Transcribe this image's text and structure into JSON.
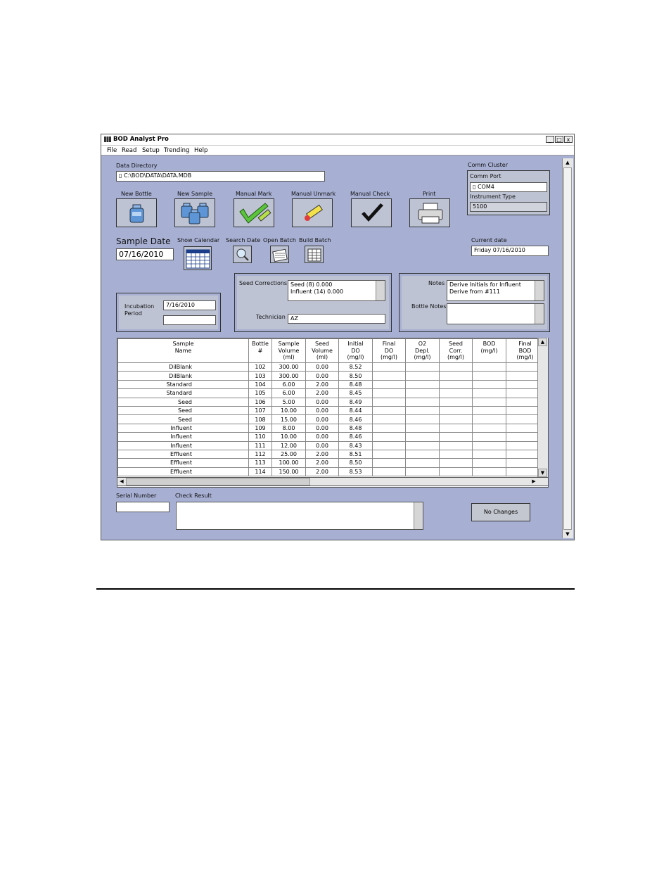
{
  "window": {
    "title": "BOD Analyst Pro",
    "min": "_",
    "max": "□",
    "close": "x"
  },
  "menu": [
    "File",
    "Read",
    "Setup",
    "Trending",
    "Help"
  ],
  "data_directory": {
    "label": "Data Directory",
    "value": "C:\\BOD\\DATA\\DATA.MDB"
  },
  "comm": {
    "cluster_label": "Comm Cluster",
    "port_label": "Comm Port",
    "port_value": "COM4",
    "instrument_label": "Instrument Type",
    "instrument_value": "5100"
  },
  "toolbar": {
    "new_bottle": "New Bottle",
    "new_sample": "New Sample",
    "manual_mark": "Manual Mark",
    "manual_unmark": "Manual Unmark",
    "manual_check": "Manual Check",
    "print": "Print"
  },
  "sample_date": {
    "label": "Sample Date",
    "value": "07/16/2010"
  },
  "small_buttons": {
    "show_calendar": "Show Calendar",
    "search_date": "Search Date",
    "open_batch": "Open Batch",
    "build_batch": "Build Batch"
  },
  "current_date": {
    "label": "Current date",
    "value": "Friday 07/16/2010"
  },
  "incubation": {
    "label_line1": "Incubation",
    "label_line2": "Period",
    "value": "7/16/2010",
    "value2": ""
  },
  "seed": {
    "label": "Seed Corrections",
    "line1": "Seed (8)       0.000",
    "line2": "Influent (14)      0.000",
    "tech_label": "Technician",
    "tech_value": "AZ"
  },
  "notes": {
    "label": "Notes",
    "line1": "Derive Initials for Influent",
    "line2": "Derive from #111",
    "bottle_label": "Bottle Notes"
  },
  "table": {
    "headers": [
      [
        "Sample",
        "Name"
      ],
      [
        "Bottle",
        "#"
      ],
      [
        "Sample",
        "Volume",
        "(ml)"
      ],
      [
        "Seed",
        "Volume",
        "(ml)"
      ],
      [
        "Initial",
        "DO",
        "(mg/l)"
      ],
      [
        "Final",
        "DO",
        "(mg/l)"
      ],
      [
        "O2",
        "Depl.",
        "(mg/l)"
      ],
      [
        "Seed",
        "Corr.",
        "(mg/l)"
      ],
      [
        "BOD",
        "(mg/l)"
      ],
      [
        "Final",
        "BOD",
        "(mg/l)"
      ]
    ],
    "rows": [
      [
        "DilBlank",
        "102",
        "300.00",
        "0.00",
        "8.52"
      ],
      [
        "DilBlank",
        "103",
        "300.00",
        "0.00",
        "8.50"
      ],
      [
        "Standard",
        "104",
        "6.00",
        "2.00",
        "8.48"
      ],
      [
        "Standard",
        "105",
        "6.00",
        "2.00",
        "8.45"
      ],
      [
        "Seed",
        "106",
        "5.00",
        "0.00",
        "8.49"
      ],
      [
        "Seed",
        "107",
        "10.00",
        "0.00",
        "8.44"
      ],
      [
        "Seed",
        "108",
        "15.00",
        "0.00",
        "8.46"
      ],
      [
        "Influent",
        "109",
        "8.00",
        "0.00",
        "8.48"
      ],
      [
        "Influent",
        "110",
        "10.00",
        "0.00",
        "8.46"
      ],
      [
        "Influent",
        "111",
        "12.00",
        "0.00",
        "8.43"
      ],
      [
        "Effluent",
        "112",
        "25.00",
        "2.00",
        "8.51"
      ],
      [
        "Effluent",
        "113",
        "100.00",
        "2.00",
        "8.50"
      ],
      [
        "Effluent",
        "114",
        "150.00",
        "2.00",
        "8.53"
      ]
    ]
  },
  "bottom": {
    "serial_label": "Serial Number",
    "check_label": "Check Result",
    "no_changes": "No Changes"
  }
}
